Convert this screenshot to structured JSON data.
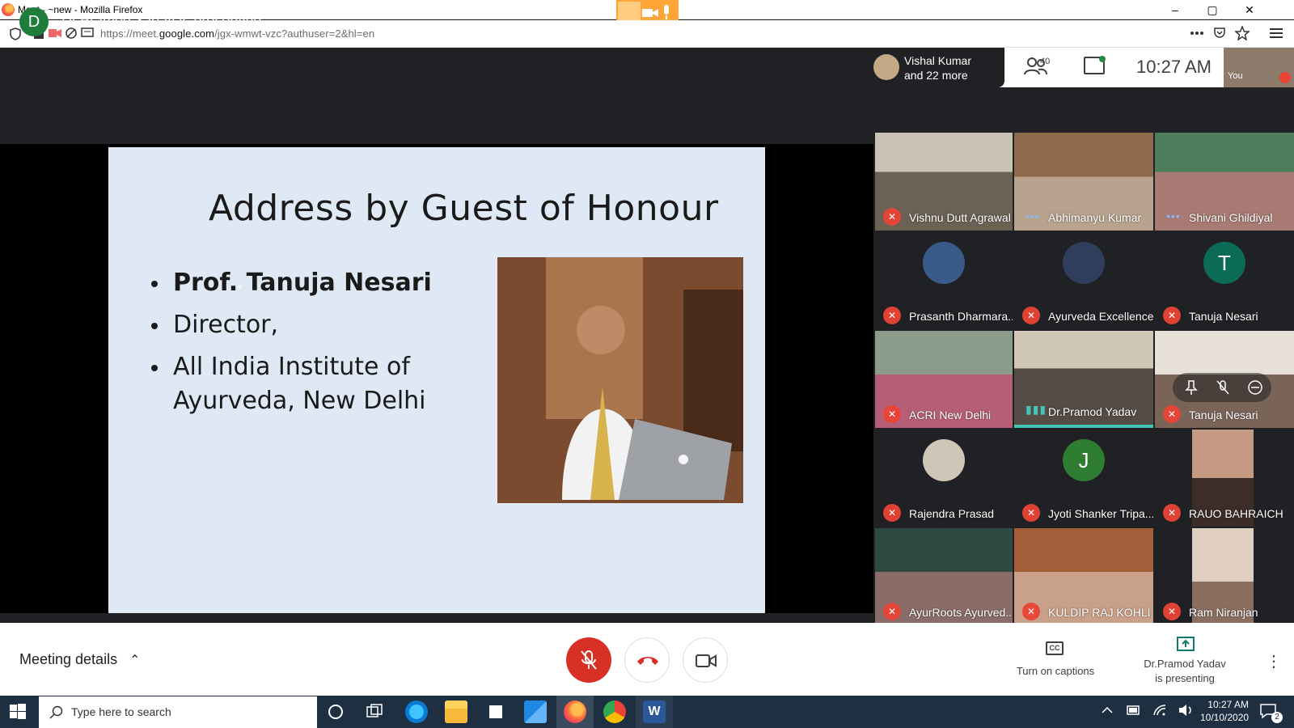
{
  "browser": {
    "title": "Meet - ~new - Mozilla Firefox",
    "url_prefix": "https://meet.",
    "url_domain": "google.com",
    "url_suffix": "/jgx-wmwt-vzc?authuser=2&hl=en",
    "min": "–",
    "max": "▢",
    "close": "✕"
  },
  "meet": {
    "presenter_initial": "D",
    "presenting_text": "Dr.Pramod Yadav is presenting",
    "participants_summary_line1": "Vishal Kumar",
    "participants_summary_line2": "and 22 more",
    "participant_count": "40",
    "clock": "10:27  AM",
    "self_label": "You"
  },
  "slide": {
    "title": "Address by Guest of Honour",
    "bullets": [
      "Prof. Tanuja Nesari",
      "Director,",
      "All India Institute of",
      "Ayurveda, New Delhi"
    ]
  },
  "tiles": [
    {
      "name": "Vishnu Dutt Agrawal",
      "indicator": "muted"
    },
    {
      "name": "Abhimanyu Kumar",
      "indicator": "dots"
    },
    {
      "name": "Shivani Ghildiyal",
      "indicator": "dots"
    },
    {
      "name": "Prasanth Dharmara...",
      "indicator": "muted"
    },
    {
      "name": "Ayurveda Excellence",
      "indicator": "muted"
    },
    {
      "name": "Tanuja Nesari",
      "indicator": "muted",
      "initial": "T"
    },
    {
      "name": "ACRI New Delhi",
      "indicator": "muted"
    },
    {
      "name": "Dr.Pramod Yadav",
      "indicator": "speaking"
    },
    {
      "name": "Tanuja Nesari",
      "indicator": "muted"
    },
    {
      "name": "Rajendra Prasad",
      "indicator": "muted"
    },
    {
      "name": "Jyoti Shanker Tripa...",
      "indicator": "muted",
      "initial": "J"
    },
    {
      "name": "RAUO BAHRAICH",
      "indicator": "muted"
    },
    {
      "name": "AyurRoots Ayurved...",
      "indicator": "muted"
    },
    {
      "name": "KULDIP RAJ KOHLI",
      "indicator": "muted"
    },
    {
      "name": "Ram Niranjan",
      "indicator": "muted"
    }
  ],
  "bottom": {
    "meeting_details": "Meeting details",
    "chevron": "⌃",
    "captions": "Turn on captions",
    "captions_icon": "CC",
    "presenting_line1": "Dr.Pramod Yadav",
    "presenting_line2": "is presenting",
    "more": "⋮"
  },
  "taskbar": {
    "search_placeholder": "Type here to search",
    "time": "10:27 AM",
    "date": "10/10/2020",
    "notifications": "2"
  },
  "colors": {
    "meet_dark": "#202124",
    "mic_red": "#d93025",
    "taskbar": "#1f2f42",
    "presenter_green": "#1e7d3a"
  }
}
